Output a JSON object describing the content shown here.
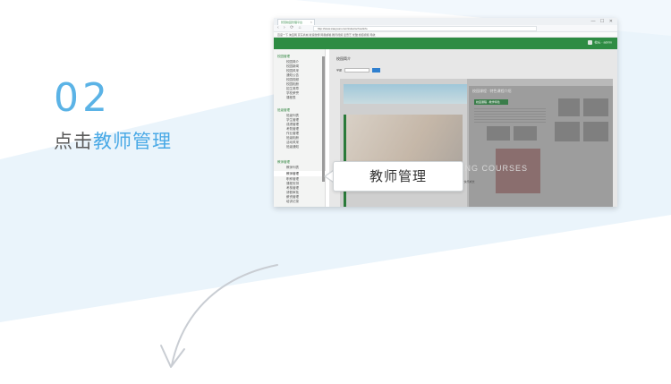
{
  "step": {
    "number": "02",
    "prefix": "点击",
    "highlight": "教师管理"
  },
  "callout": {
    "label": "教师管理"
  },
  "browser": {
    "tab_title": "智慧校园管理平台",
    "url": "http://www.xiaoyuan.com/index/schoolinfo",
    "bookmarks": "百度一下  淘宝网  京东商城  新浪微博  网易邮箱  腾讯视频  爱奇艺  优酷  搜狐视频  导航",
    "window_controls": "— ☐ ✕",
    "nav_glyphs": "‹ › ⟳ ⌂",
    "user": "校长  ·  admin"
  },
  "sidebar": {
    "groups": [
      {
        "label": "校园管理",
        "items": [
          "校园简介",
          "校园新闻",
          "校园风采",
          "通知公告",
          "校园视频",
          "校园相册",
          "招生简章",
          "学校荣誉",
          "课程表"
        ]
      },
      {
        "label": "班级管理",
        "items": [
          "班级列表",
          "学生管理",
          "成绩管理",
          "考勤管理",
          "作业管理",
          "班级相册",
          "活动风采",
          "班级通知"
        ]
      },
      {
        "label": "教师管理",
        "items": [
          "教师列表",
          "职称管理",
          "课程安排",
          "考核管理",
          "请假审批",
          "薪资管理",
          "培训记录"
        ]
      }
    ],
    "active_item": "教师管理"
  },
  "main": {
    "breadcrumb": "校园简介",
    "filter_label": "学期",
    "poster_title": "校园课程 · 特色课程介绍",
    "poster_chip": "校园课程 · 教学特色",
    "poster_big": "LUJIANG\nCOURSES",
    "poster_foot": "特色课程 · 快乐成长"
  },
  "colors": {
    "accent": "#5bb3e6",
    "app_green": "#2e8c43",
    "band": "#eaf4fb"
  }
}
